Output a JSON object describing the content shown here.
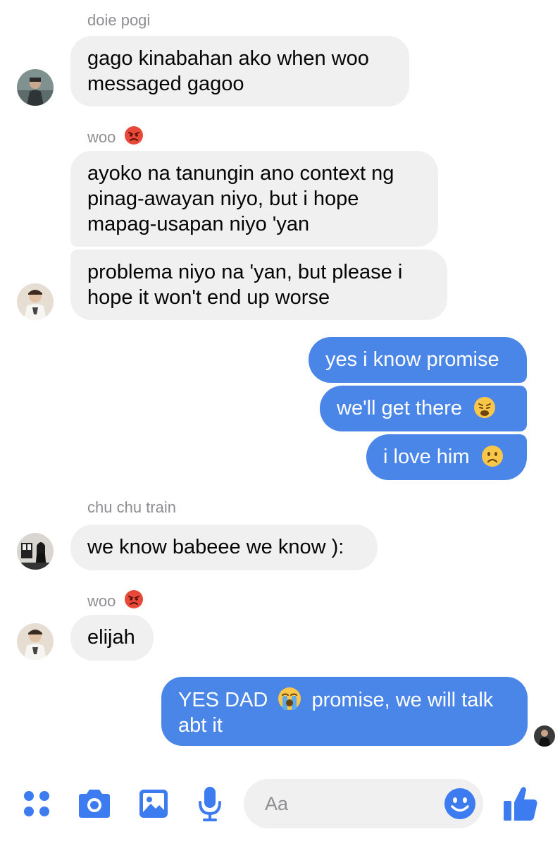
{
  "messages": {
    "group1": {
      "sender": "doie pogi",
      "lines": [
        "gago kinabahan ako when woo",
        "messaged gagoo"
      ]
    },
    "group2": {
      "sender": "woo",
      "bubble1": [
        "ayoko na tanungin ano context ng",
        "pinag-awayan niyo, but i hope",
        "mapag-usapan niyo 'yan"
      ],
      "bubble2": [
        "problema niyo na 'yan, but please i",
        "hope it won't end up worse"
      ]
    },
    "outgoing1": {
      "bubble1": "yes i know promise",
      "bubble2": "we'll get there",
      "bubble3": "i love him"
    },
    "group3": {
      "sender": "chu chu train",
      "text": "we know babeee we know ):"
    },
    "group4": {
      "sender": "woo",
      "text": "elijah"
    },
    "outgoing2": {
      "text_part1": "YES DAD",
      "text_part2": "promise, we will talk",
      "text_line2": "abt it"
    }
  },
  "composer": {
    "placeholder": "Aa"
  },
  "icons": [
    "apps-icon",
    "camera-icon",
    "gallery-icon",
    "microphone-icon",
    "emoji-icon",
    "thumbs-up-icon"
  ],
  "colors": {
    "accent": "#4a86e8",
    "incoming_bubble": "#f0f0f0",
    "icon_blue": "#3d7bf0"
  }
}
